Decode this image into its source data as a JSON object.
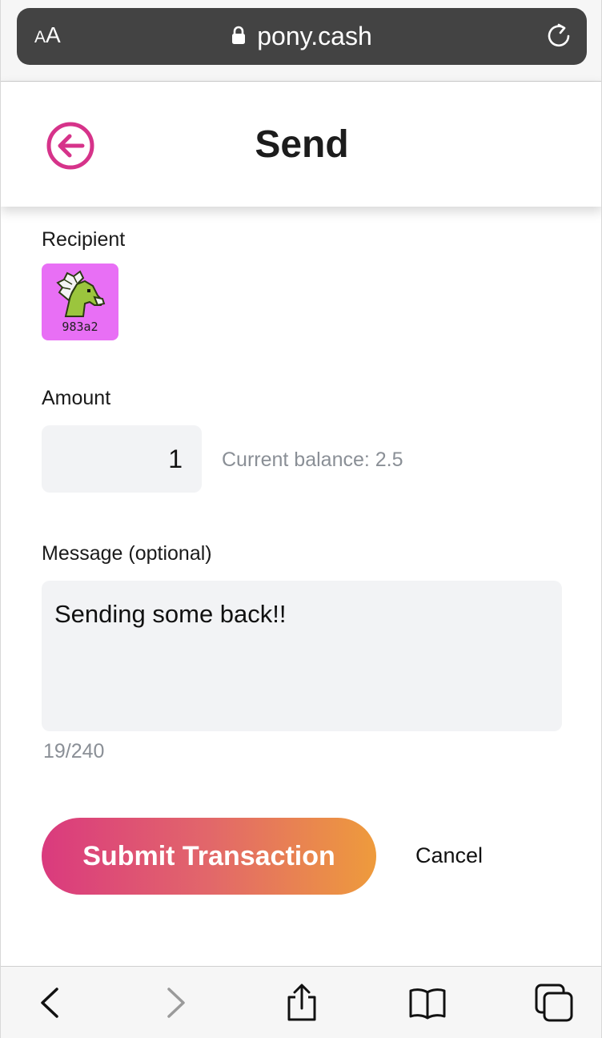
{
  "browser": {
    "text_size_label_small": "A",
    "text_size_label_large": "A",
    "url": "pony.cash",
    "icons": [
      "lock-icon",
      "reload-icon",
      "back-chevron-icon",
      "forward-chevron-icon",
      "share-icon",
      "bookmarks-icon",
      "tabs-icon"
    ]
  },
  "header": {
    "title": "Send",
    "back_icon": "circle-arrow-left-icon",
    "accent_color": "#d6338a"
  },
  "form": {
    "recipient_label": "Recipient",
    "recipient": {
      "id": "983a2",
      "avatar_color": "#e86ff5",
      "avatar_icon": "pony-icon"
    },
    "amount_label": "Amount",
    "amount_value": "1",
    "balance_text": "Current balance: 2.5",
    "message_label": "Message (optional)",
    "message_value": "Sending some back!!",
    "char_counter": "19/240"
  },
  "actions": {
    "submit_label": "Submit Transaction",
    "cancel_label": "Cancel",
    "submit_gradient": [
      "#da3a7e",
      "#ee9b3c"
    ]
  }
}
